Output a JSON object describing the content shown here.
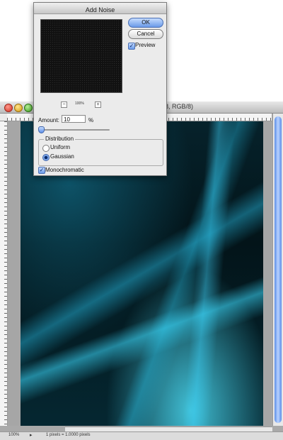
{
  "document": {
    "title_fragment": "8, RGB/8)",
    "zoom": "100%",
    "status": "1 pixels = 1.0000 pixels"
  },
  "dialog": {
    "title": "Add Noise",
    "preview_zoom": "100%",
    "ok_label": "OK",
    "cancel_label": "Cancel",
    "preview_label": "Preview",
    "preview_checked": true,
    "amount_label": "Amount:",
    "amount_value": "10",
    "amount_unit": "%",
    "distribution_label": "Distribution",
    "distribution_options": [
      "Uniform",
      "Gaussian"
    ],
    "distribution_selected": "Gaussian",
    "monochromatic_label": "Monochromatic",
    "monochromatic_checked": true
  },
  "icons": {
    "zoom_out": "minus-icon",
    "zoom_in": "plus-icon",
    "checkbox": "checkmark-icon"
  }
}
